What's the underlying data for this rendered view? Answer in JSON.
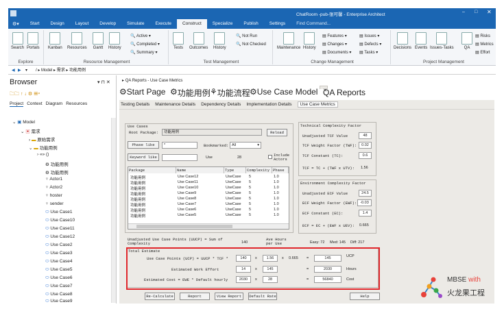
{
  "window": {
    "title": "ChatRoom -pub-张可馨 - Enterprise Architect"
  },
  "ribbon_tabs": [
    "Start",
    "Design",
    "Layout",
    "Develop",
    "Simulate",
    "Execute",
    "Construct",
    "Specialize",
    "Publish",
    "Settings",
    "Find Command..."
  ],
  "ribbon": {
    "explore": {
      "caption": "Explore",
      "search": "Search",
      "portals": "Portals"
    },
    "resource": {
      "caption": "Resource Management",
      "kanban": "Kanban",
      "resources": "Resources",
      "gantt": "Gantt",
      "history": "History",
      "active": "Active",
      "completed": "Completed",
      "summary": "Summary"
    },
    "test": {
      "caption": "Test Management",
      "tests": "Tests",
      "outcomes": "Outcomes",
      "history": "History",
      "notrun": "Not Run",
      "notchecked": "Not Checked"
    },
    "change": {
      "caption": "Change Management",
      "maintenance": "Maintenance",
      "history": "History",
      "features": "Features",
      "changes": "Changes",
      "documents": "Documents",
      "issues": "Issues",
      "defects": "Defects",
      "tasks": "Tasks"
    },
    "project": {
      "caption": "Project Management",
      "decisions": "Decisions",
      "events": "Events",
      "issuestasks": "Issues-Tasks",
      "qa": "QA",
      "risks": "Risks",
      "metrics": "Metrics",
      "effort": "Effort"
    }
  },
  "address": {
    "path": "/ ▸ Model ▸ 需求 ▸ 功能用例"
  },
  "browser": {
    "title": "Browser",
    "tabs": [
      "Project",
      "Context",
      "Diagram",
      "Resources"
    ],
    "tree": [
      "Model",
      "需求",
      "原始需求",
      "功能用例",
      "«» ()",
      "功能用例",
      "功能用例",
      "Actor1",
      "Actor2",
      "hoster",
      "sender",
      "Use Case1",
      "Use Case10",
      "Use Case11",
      "Use Case12",
      "Use Case2",
      "Use Case3",
      "Use Case4",
      "Use Case5",
      "Use Case6",
      "Use Case7",
      "Use Case8",
      "Use Case9"
    ]
  },
  "doc": {
    "breadcrumb": "QA Reports - Use Case Metrics",
    "tabs": [
      "Start Page",
      "功能用例",
      "功能流程",
      "Use Case Model",
      "QA Reports"
    ],
    "subtabs": [
      "Testing Details",
      "Maintenance Details",
      "Dependency Details",
      "Implementation Details",
      "Use Case Metrics"
    ]
  },
  "usecases": {
    "title": "Use Cases",
    "root_label": "Root Package:",
    "root_value": "功能用例",
    "reload": "Reload",
    "phase_btn": "Phase like",
    "phase_val": "*",
    "bookmarked_label": "Bookmarked:",
    "bookmarked_val": "All",
    "keyword_btn": "Keyword like",
    "use_label": "Use",
    "use_count": "28",
    "include_actors": "Include Actors",
    "columns": [
      "Package",
      "Name",
      "Type",
      "Complexity",
      "Phase"
    ],
    "rows": [
      [
        "功能用例",
        "Use Case12",
        "UseCase",
        "5",
        "1.0"
      ],
      [
        "功能用例",
        "Use Case11",
        "UseCase",
        "5",
        "1.0"
      ],
      [
        "功能用例",
        "Use Case10",
        "UseCase",
        "5",
        "1.0"
      ],
      [
        "功能用例",
        "Use Case9",
        "UseCase",
        "5",
        "1.0"
      ],
      [
        "功能用例",
        "Use Case8",
        "UseCase",
        "5",
        "1.0"
      ],
      [
        "功能用例",
        "Use Case7",
        "UseCase",
        "5",
        "1.0"
      ],
      [
        "功能用例",
        "Use Case6",
        "UseCase",
        "5",
        "1.0"
      ],
      [
        "功能用例",
        "Use Case5",
        "UseCase",
        "5",
        "1.0"
      ]
    ]
  },
  "tech": {
    "title": "Technical Complexity Factor",
    "rows": [
      [
        "Unadjusted TCF Value",
        "48"
      ],
      [
        "TCF Weight Factor (TWF):",
        "0.02"
      ],
      [
        "TCF Constant (TC):",
        "0.6"
      ],
      [
        "TCF = TC + (TWF x UTV):",
        "1.56"
      ]
    ]
  },
  "env": {
    "title": "Environment Complexity Factor",
    "rows": [
      [
        "Unadjusted ECF Value",
        "24.5"
      ],
      [
        "ECF Weight Factor (EWF):",
        "-0.03"
      ],
      [
        "ECF Constant (EC):",
        "1.4"
      ],
      [
        "ECF = EC + (EWF x UEV):",
        "0.665"
      ]
    ]
  },
  "uucp": {
    "label": "Unadjusted Use Case Points (UUCP) = Sum of Complexity",
    "value": "140",
    "avg_label": "Ave Hours per Use",
    "easy": "Easy: 72",
    "med": "Med: 145",
    "diff": "Diff: 217"
  },
  "estimate": {
    "title": "Total Estimate",
    "ucp_label": "Use Case Points (UCP) = UUCP * TCF *",
    "ucp": [
      "140",
      "1.56",
      "0.665",
      "145"
    ],
    "ucp_unit": "UCP",
    "effort_label": "Estimated Work Effort",
    "effort": [
      "14",
      "145",
      "2030"
    ],
    "effort_unit": "Hours",
    "cost_label": "Estimated Cost = EWE * Default hourly",
    "cost": [
      "2030",
      "28",
      "56840"
    ],
    "cost_unit": "Cost"
  },
  "buttons": [
    "Re-Calculate",
    "Report",
    "View Report",
    "Default Rate",
    "Help"
  ],
  "watermark": {
    "line1": "MBSE",
    "with": "with",
    "line2": "火龙果工程"
  },
  "colors": {
    "titlebar": "#1b66b3",
    "highlight": "#e0262b"
  }
}
